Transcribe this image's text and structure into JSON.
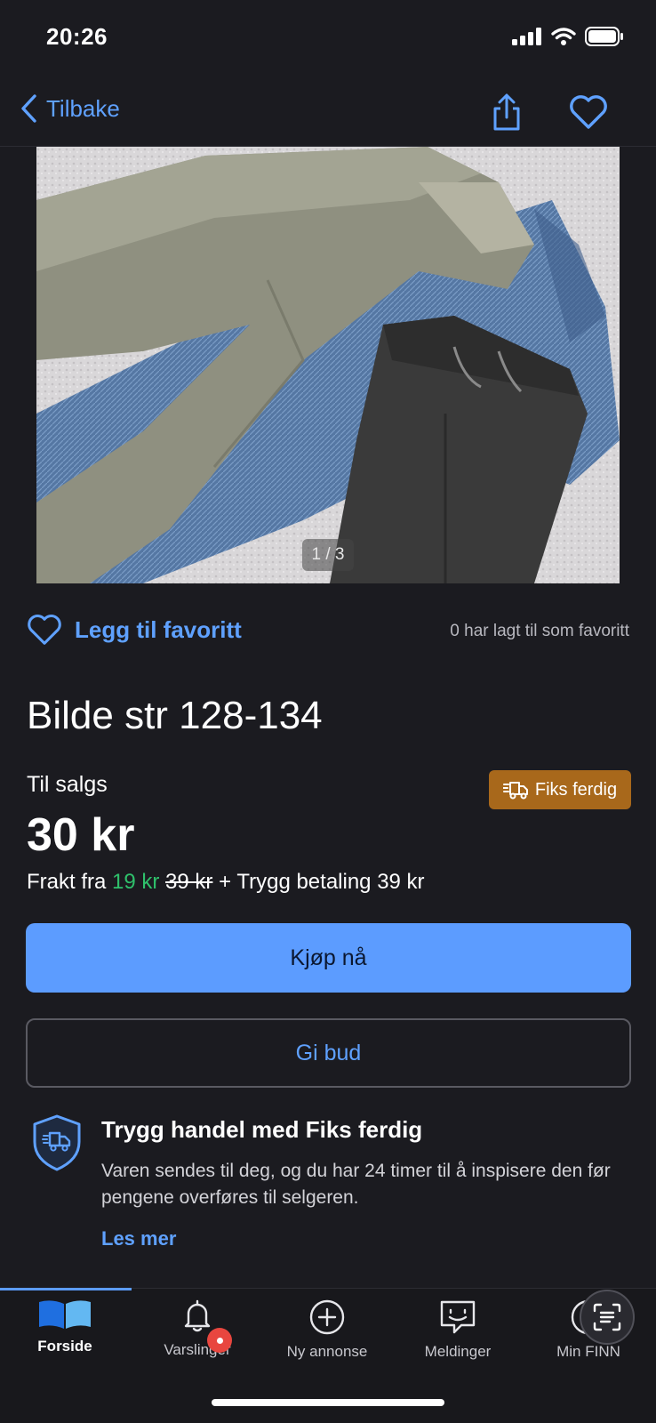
{
  "status_bar": {
    "time": "20:26"
  },
  "nav": {
    "back_label": "Tilbake"
  },
  "gallery": {
    "pager": "1 / 3"
  },
  "favorite": {
    "label": "Legg til favoritt",
    "count_text": "0 har lagt til som favoritt"
  },
  "listing": {
    "title": "Bilde str 128-134",
    "sale_label": "Til salgs",
    "badge": "Fiks ferdig",
    "price": "30 kr",
    "shipping_prefix": "Frakt fra",
    "shipping_price": "19 kr",
    "shipping_old": "39 kr",
    "shipping_suffix": "+ Trygg betaling 39 kr"
  },
  "actions": {
    "buy": "Kjøp nå",
    "bid": "Gi bud"
  },
  "safe_trade": {
    "title": "Trygg handel med Fiks ferdig",
    "text": "Varen sendes til deg, og du har 24 timer til å inspisere den før pengene overføres til selgeren.",
    "link": "Les mer"
  },
  "tabs": [
    {
      "label": "Forside",
      "icon": "finn-home-icon",
      "active": true
    },
    {
      "label": "Varslinger",
      "icon": "bell-icon"
    },
    {
      "label": "Ny annonse",
      "icon": "plus-circle-icon"
    },
    {
      "label": "Meldinger",
      "icon": "chat-icon"
    },
    {
      "label": "Min FINN",
      "icon": "user-icon"
    }
  ],
  "colors": {
    "accent": "#5c9cff",
    "badge": "#a8681b",
    "price_green": "#2fc06b",
    "background": "#1b1b20"
  }
}
